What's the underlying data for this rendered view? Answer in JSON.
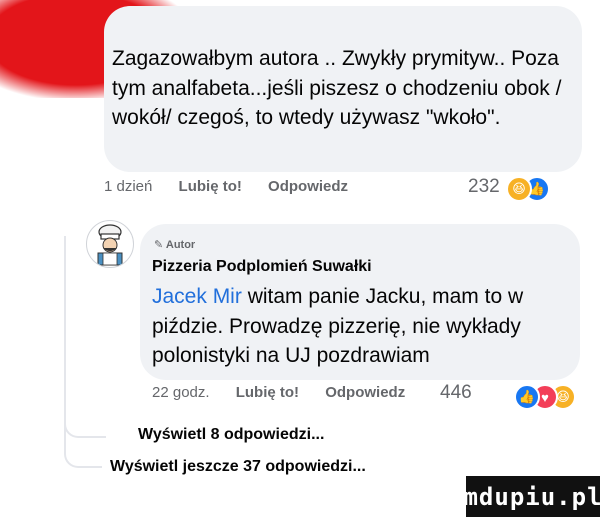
{
  "comment1": {
    "text": "Zagazowałbym autora .. Zwykły prymityw.. Poza tym analfabeta...jeśli piszesz o chodzeniu obok / wokół/ czegoś,  to wtedy używasz \"wkoło\".",
    "time": "1 dzień",
    "like_label": "Lubię to!",
    "reply_label": "Odpowiedz",
    "reaction_count": "232",
    "reactions": [
      {
        "name": "haha",
        "color": "#f7b125",
        "glyph": "😆"
      },
      {
        "name": "like",
        "color": "#1877f2",
        "glyph": "👍"
      }
    ]
  },
  "comment2": {
    "author_tag": "Autor",
    "author_name": "Pizzeria Podplomień Suwałki",
    "mention": "Jacek Mir",
    "text": " witam panie Jacku, mam to w piździe. Prowadzę pizzerię, nie wykłady polonistyki na UJ pozdrawiam",
    "time": "22 godz.",
    "like_label": "Lubię to!",
    "reply_label": "Odpowiedz",
    "reaction_count": "446",
    "reactions": [
      {
        "name": "like",
        "color": "#1877f2",
        "glyph": "👍"
      },
      {
        "name": "love",
        "color": "#f33e58",
        "glyph": "♥"
      },
      {
        "name": "haha",
        "color": "#f7b125",
        "glyph": "😆"
      }
    ]
  },
  "view_replies_label": "Wyświetl 8 odpowiedzi...",
  "view_more_label": "Wyświetl jeszcze 37 odpowiedzi...",
  "watermark": "mdupiu.pl"
}
